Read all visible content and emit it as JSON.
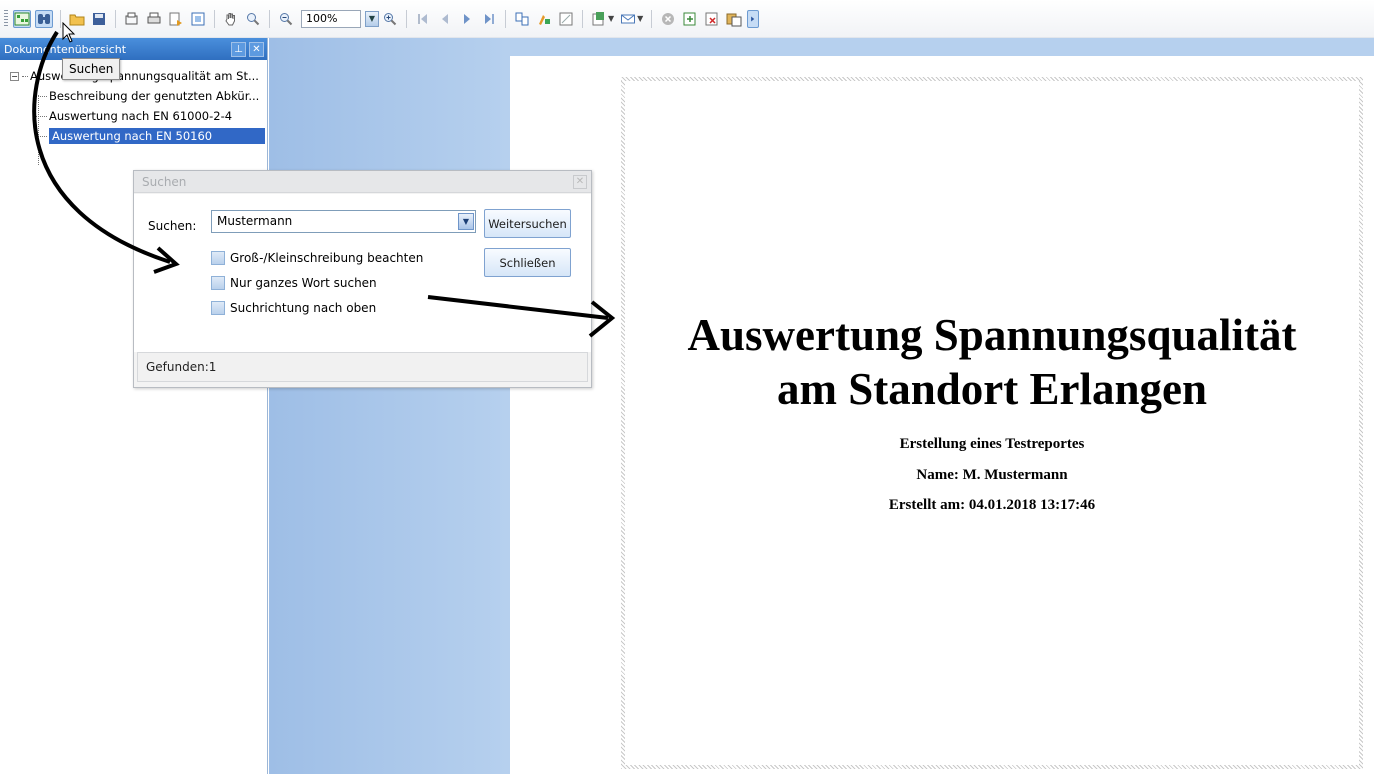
{
  "toolbar": {
    "zoom_value": "100%",
    "buttons": [
      "document-map-icon",
      "search-icon",
      "open-icon",
      "save-icon",
      "print-setup-icon",
      "print-icon",
      "export-icon",
      "page-setup-icon",
      "hand-icon",
      "zoom-tool-icon",
      "zoom-out-icon",
      "zoom-in-icon",
      "first-page-icon",
      "previous-page-icon",
      "next-page-icon",
      "last-page-icon",
      "multiple-pages-icon",
      "color-icon",
      "watermark-icon",
      "export-dropdown-icon",
      "email-dropdown-icon",
      "stop-icon",
      "open-document-icon",
      "close-document-icon",
      "copy-icon",
      "overflow-icon"
    ]
  },
  "tooltip": {
    "text": "Suchen"
  },
  "doc_panel": {
    "title": "Dokumentenübersicht",
    "tree": {
      "root": "Auswertung Spannungsqualität am St...",
      "children": [
        "Beschreibung der genutzten Abkür...",
        "Auswertung nach EN 61000-2-4",
        "Auswertung nach EN 50160"
      ],
      "selected_index": 2
    }
  },
  "search_dialog": {
    "title": "Suchen",
    "label": "Suchen:",
    "query": "Mustermann",
    "find_next": "Weitersuchen",
    "close": "Schließen",
    "options": [
      "Groß-/Kleinschreibung beachten",
      "Nur ganzes Wort suchen",
      "Suchrichtung nach oben"
    ],
    "status": "Gefunden:1"
  },
  "report": {
    "title_line1": "Auswertung Spannungsqualität",
    "title_line2": "am Standort Erlangen",
    "subtitle": "Erstellung eines Testreportes",
    "name": "Name: M. Mustermann",
    "created": "Erstellt am: 04.01.2018 13:17:46"
  }
}
